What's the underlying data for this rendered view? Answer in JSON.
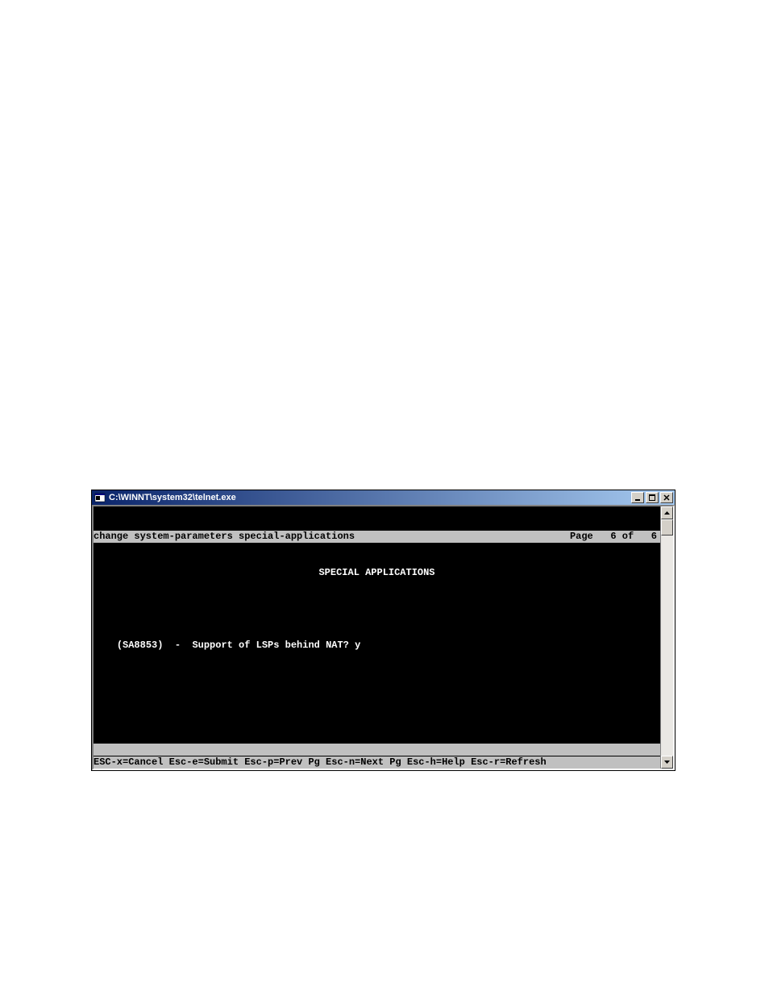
{
  "window": {
    "title": "C:\\WINNT\\system32\\telnet.exe"
  },
  "terminal": {
    "command": "change system-parameters special-applications",
    "page_label": "Page",
    "page_current": "6",
    "page_of": "of",
    "page_total": "6",
    "title": "SPECIAL APPLICATIONS",
    "field_code": "(SA8853)",
    "field_sep": "-",
    "field_label": "Support of LSPs behind NAT?",
    "field_value": "y",
    "help_line": "ESC-x=Cancel Esc-e=Submit Esc-p=Prev Pg Esc-n=Next Pg Esc-h=Help Esc-r=Refresh"
  }
}
